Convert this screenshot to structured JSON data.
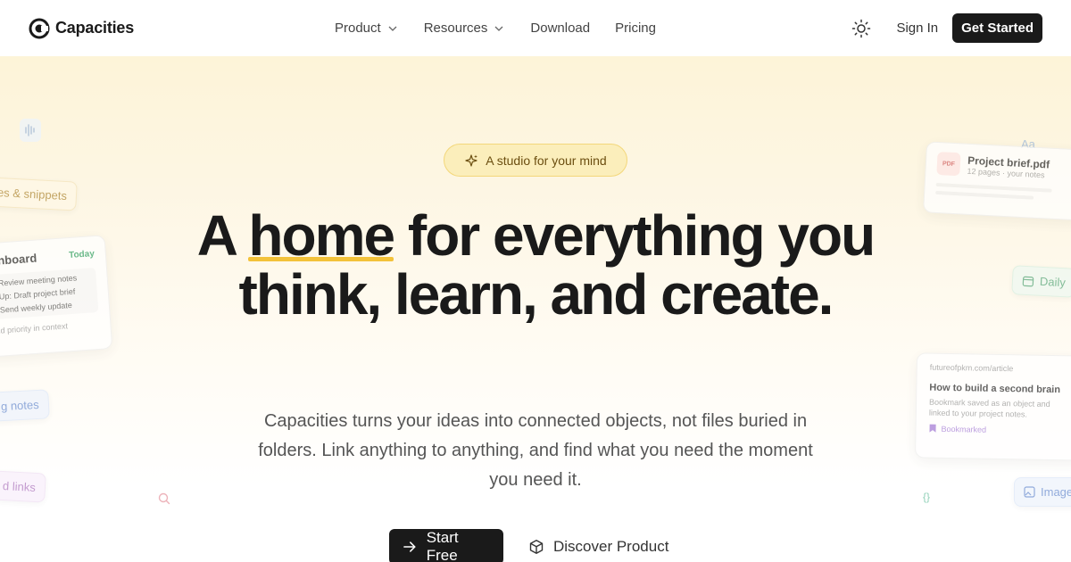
{
  "brand": {
    "name": "Capacities"
  },
  "nav": {
    "links": [
      {
        "label": "Product",
        "dropdown": true
      },
      {
        "label": "Resources",
        "dropdown": true
      },
      {
        "label": "Download",
        "dropdown": false
      },
      {
        "label": "Pricing",
        "dropdown": false
      }
    ],
    "theme_icon": "sun-icon",
    "signin_label": "Sign In",
    "cta_label": "Get Started"
  },
  "hero": {
    "badge": "A studio for your mind",
    "headline_pre": "A ",
    "headline_highlight": "home",
    "headline_post": " for everything you think, learn, and create.",
    "subtitle": "Capacities turns your ideas into connected objects, not files buried in folders. Link anything to anything, and find what you need the moment you need it.",
    "primary_cta": "Start Free",
    "secondary_cta": "Discover Product"
  },
  "decor": {
    "left_chip_top": "es & snippets",
    "dashboard_title": "shboard",
    "dashboard_badge": "Today",
    "dashboard_items": [
      "Review meeting notes",
      "Up: Draft project brief",
      "Send weekly update"
    ],
    "dashboard_footer": "nd priority in context",
    "left_chip_mid": "g notes",
    "left_chip_bottom": "d links",
    "pdf_title": "Project brief.pdf",
    "pdf_meta": "12 pages · your notes",
    "pdf_tag": "PDF",
    "aa_label": "Aa",
    "daily_label": "Daily",
    "article_url": "futureofpkm.com/article",
    "article_title": "How to build a second brain",
    "article_desc": "Bookmark saved as an object and linked to your project notes.",
    "article_tag": "Bookmarked",
    "image_label": "Image",
    "code_label": "{}"
  },
  "colors": {
    "accent_yellow": "#f3c23a",
    "dark": "#1a1a1a",
    "badge_bg": "#fbeebb"
  }
}
